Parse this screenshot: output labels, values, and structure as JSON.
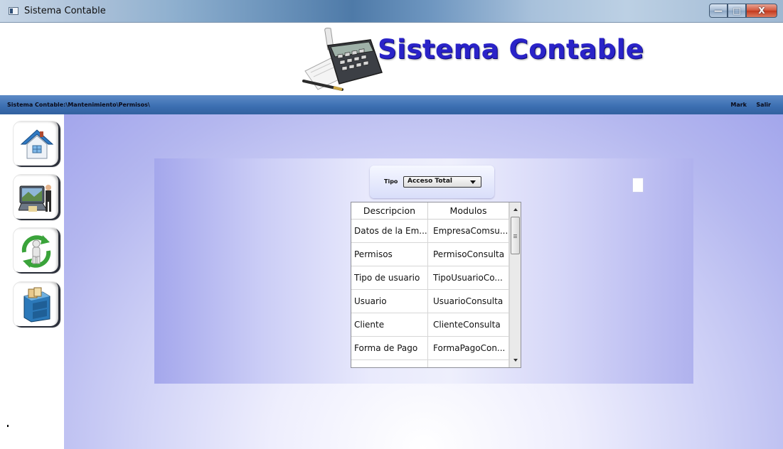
{
  "window": {
    "title": "Sistema Contable",
    "controls": {
      "minimize": "—",
      "maximize": "□",
      "close": "X"
    }
  },
  "header": {
    "logo_text": "Sistema Contable"
  },
  "pathbar": {
    "path": "Sistema Contable:\\Mantenimiento\\Permisos\\",
    "user": "Mark",
    "exit": "Salir"
  },
  "sidebar": {
    "items": [
      {
        "icon": "home-icon"
      },
      {
        "icon": "computer-user-icon"
      },
      {
        "icon": "refresh-person-icon"
      },
      {
        "icon": "filing-cabinet-icon"
      }
    ]
  },
  "filter": {
    "label": "Tipo",
    "selected": "Acceso Total"
  },
  "grid": {
    "columns": [
      "Descripcion",
      "Modulos"
    ],
    "rows": [
      [
        "Datos de la Em...",
        "EmpresaComsu..."
      ],
      [
        "Permisos",
        "PermisoConsulta"
      ],
      [
        "Tipo de usuario",
        "TipoUsuarioCo..."
      ],
      [
        "Usuario",
        "UsuarioConsulta"
      ],
      [
        "Cliente",
        "ClienteConsulta"
      ],
      [
        "Forma de Pago",
        "FormaPagoCon..."
      ]
    ]
  },
  "colors": {
    "logo_text": "#2a23c8",
    "pathbar": "#3b6eb1",
    "panel_accent": "#a4a7ec"
  }
}
